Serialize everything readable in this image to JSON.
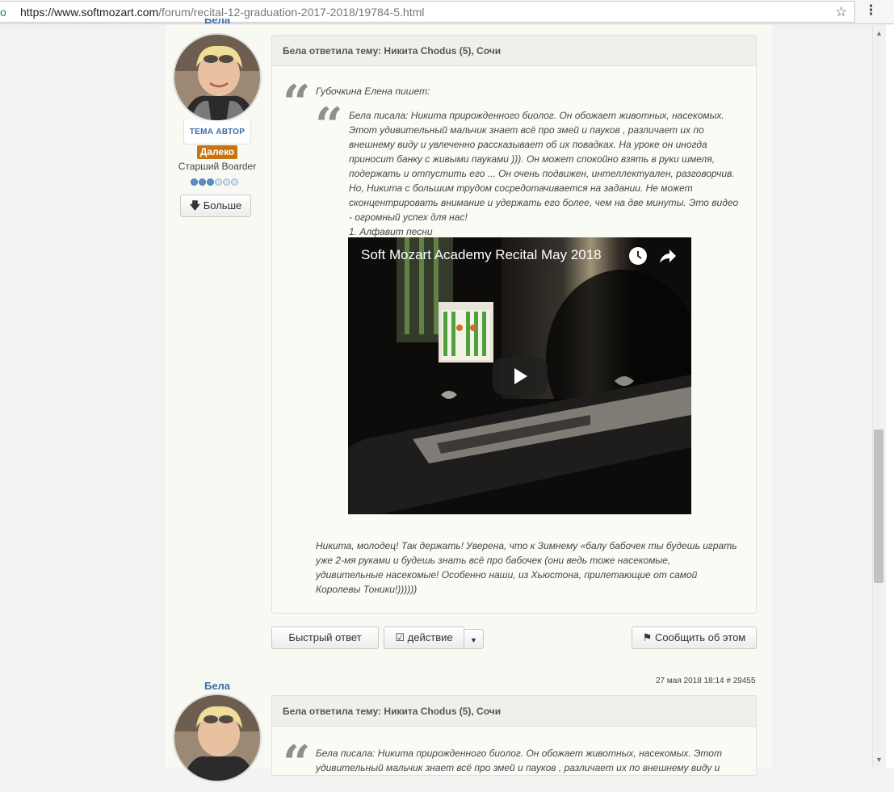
{
  "browser": {
    "scheme_glyph": "o",
    "url_host": "https://www.softmozart.com",
    "url_path": "/forum/recital-12-graduation-2017-2018/19784-5.html"
  },
  "post1": {
    "author_name": "Бела",
    "role_badge": "ТЕМА АВТОР",
    "status": "Далеко",
    "rank": "Старший Boarder",
    "rank_level": 3,
    "rank_max": 6,
    "more_label": "Больше",
    "header": "Бела ответила тему: Никита Chodus (5), Сочи",
    "quote_author": "Губочкина Елена пишет:",
    "inner_quote": "Бела писала: Никита прирожденного биолог. Он обожает животных, насекомых. Этот удивительный мальчик знает всё про змей и пауков , различает их по внешнему виду и увлеченно рассказывает об их повадках. На уроке он иногда приносит банку с живыми пауками ))). Он может спокойно взять в руки шмеля, подержать и отпустить его ... Он очень подвижен, интеллектуален, разговорчив. Но, Никита с большим трудом сосредотачивается на задании. Не может сконцентрировать внимание и удержать его более, чем на две минуты. Это видео - огромный успех для нас!",
    "list_item": "1. Алфавит песни",
    "video_title": "Soft Mozart Academy Recital May 2018",
    "closing_text": "Никита, молодец! Так держать! Уверена, что к Зимнему «балу бабочек ты будешь играть уже 2-мя руками и будешь знать всё про бабочек (они ведь тоже насекомые, удивительные насекомые! Особенно наши, из Хьюстона, прилетающие от самой Королевы Тоники!))))))",
    "quick_reply_label": "Быстрый ответ",
    "action_label": "действие",
    "report_label": "Сообщить об этом"
  },
  "post2": {
    "meta": "27 мая 2018 18:14 # 29455",
    "author_name": "Бела",
    "header": "Бела ответила тему: Никита Chodus (5), Сочи",
    "text": "Бела писала: Никита прирожденного биолог. Он обожает животных, насекомых. Этот удивительный мальчик знает всё про змей и пауков , различает их по внешнему виду и"
  },
  "colors": {
    "link_blue": "#3a6ea5",
    "status_orange": "#c8750e",
    "page_bg": "#f9f9f4"
  }
}
